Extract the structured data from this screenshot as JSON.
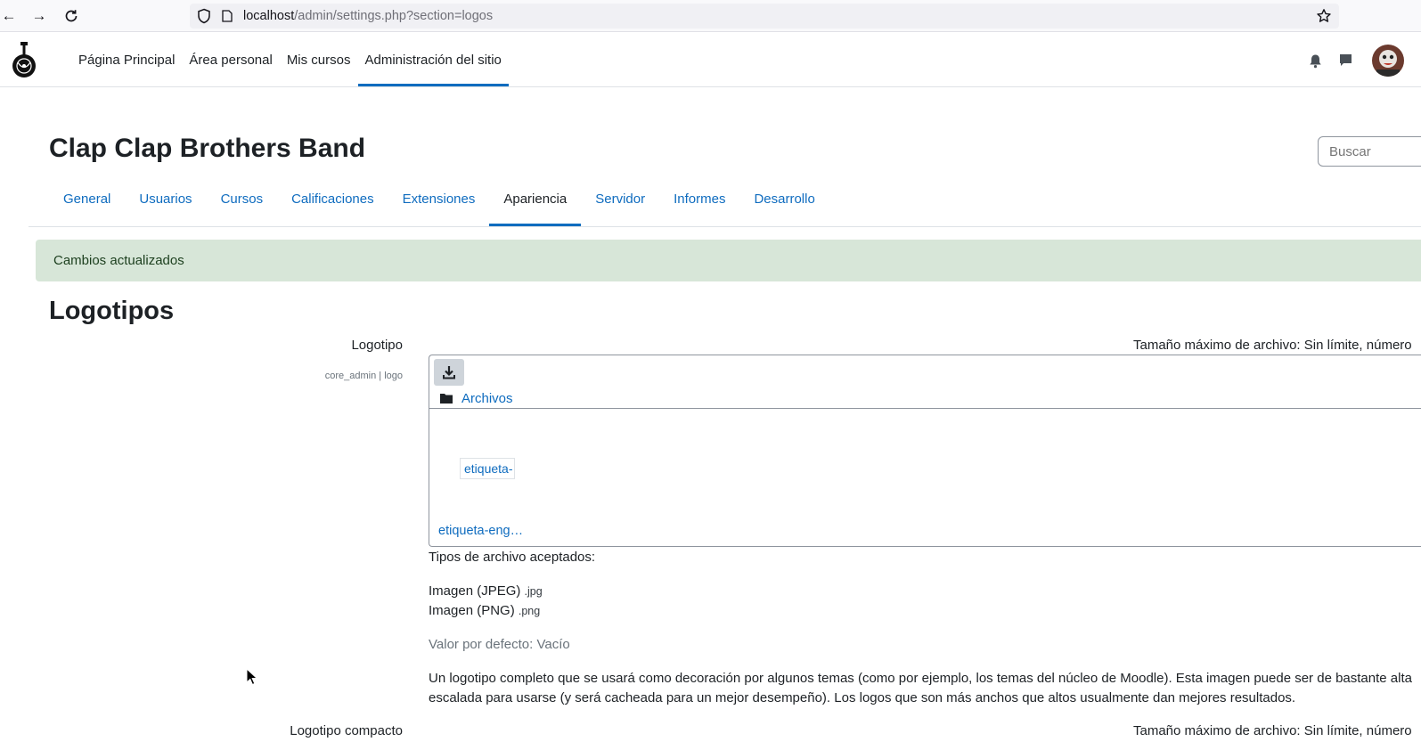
{
  "browser": {
    "url_host": "localhost",
    "url_path": "/admin/settings.php?section=logos"
  },
  "navbar": {
    "items": [
      {
        "label": "Página Principal"
      },
      {
        "label": "Área personal"
      },
      {
        "label": "Mis cursos"
      },
      {
        "label": "Administración del sitio",
        "active": true
      }
    ]
  },
  "header": {
    "title": "Clap Clap Brothers Band",
    "search_placeholder": "Buscar"
  },
  "tabs": [
    {
      "label": "General"
    },
    {
      "label": "Usuarios"
    },
    {
      "label": "Cursos"
    },
    {
      "label": "Calificaciones"
    },
    {
      "label": "Extensiones"
    },
    {
      "label": "Apariencia",
      "active": true
    },
    {
      "label": "Servidor"
    },
    {
      "label": "Informes"
    },
    {
      "label": "Desarrollo"
    }
  ],
  "alert": {
    "message": "Cambios actualizados"
  },
  "section": {
    "title": "Logotipos"
  },
  "settings": {
    "logo": {
      "label": "Logotipo",
      "key": "core_admin | logo",
      "max_size": "Tamaño máximo de archivo: Sin límite, número",
      "filemanager": {
        "path_label": "Archivos",
        "thumb_label": "etiqueta-",
        "file_name": "etiqueta-eng…"
      },
      "accepted_title": "Tipos de archivo aceptados:",
      "accepted": [
        {
          "name": "Imagen (JPEG)",
          "ext": ".jpg"
        },
        {
          "name": "Imagen (PNG)",
          "ext": ".png"
        }
      ],
      "default_value": "Valor por defecto: Vacío",
      "description_line1": "Un logotipo completo que se usará como decoración por algunos temas (como por ejemplo, los temas del núcleo de Moodle). Esta imagen puede ser de bastante alta",
      "description_line2": "escalada para usarse (y será cacheada para un mejor desempeño). Los logos que son más anchos que altos usualmente dan mejores resultados."
    },
    "compact_logo": {
      "label": "Logotipo compacto",
      "max_size": "Tamaño máximo de archivo: Sin límite, número"
    }
  },
  "colors": {
    "link": "#0f6cbf",
    "alert_bg": "#d7e6d8",
    "text": "#1d2125"
  }
}
